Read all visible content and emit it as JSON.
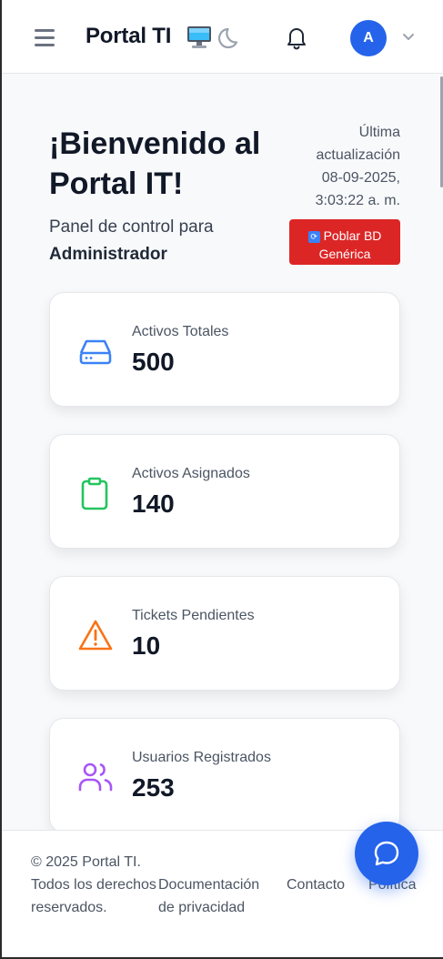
{
  "header": {
    "brand": "Portal TI",
    "avatar_initial": "A",
    "icons": [
      "menu-icon",
      "monitor-icon",
      "moon-icon",
      "bell-icon",
      "chevron-down-icon"
    ]
  },
  "welcome": {
    "title": "¡Bienvenido al Portal IT!",
    "subtitle": "Panel de control para",
    "role": "Administrador",
    "last_update_label": "Última actualización",
    "last_update_value": "08-09-2025, 3:03:22 a. m.",
    "populate_button": "Poblar BD Genérica"
  },
  "cards": [
    {
      "label": "Activos Totales",
      "value": "500",
      "icon": "hard-drive-icon",
      "color": "#3b82f6"
    },
    {
      "label": "Activos Asignados",
      "value": "140",
      "icon": "clipboard-icon",
      "color": "#22c55e"
    },
    {
      "label": "Tickets Pendientes",
      "value": "10",
      "icon": "alert-triangle-icon",
      "color": "#f97316"
    },
    {
      "label": "Usuarios Registrados",
      "value": "253",
      "icon": "users-icon",
      "color": "#a855f7"
    }
  ],
  "footer": {
    "copyright": "© 2025 Portal TI. Todos los derechos reservados.",
    "links": [
      "Documentación de privacidad",
      "Contacto",
      "Política"
    ]
  },
  "colors": {
    "primary": "#2563eb",
    "danger": "#dc2626"
  }
}
